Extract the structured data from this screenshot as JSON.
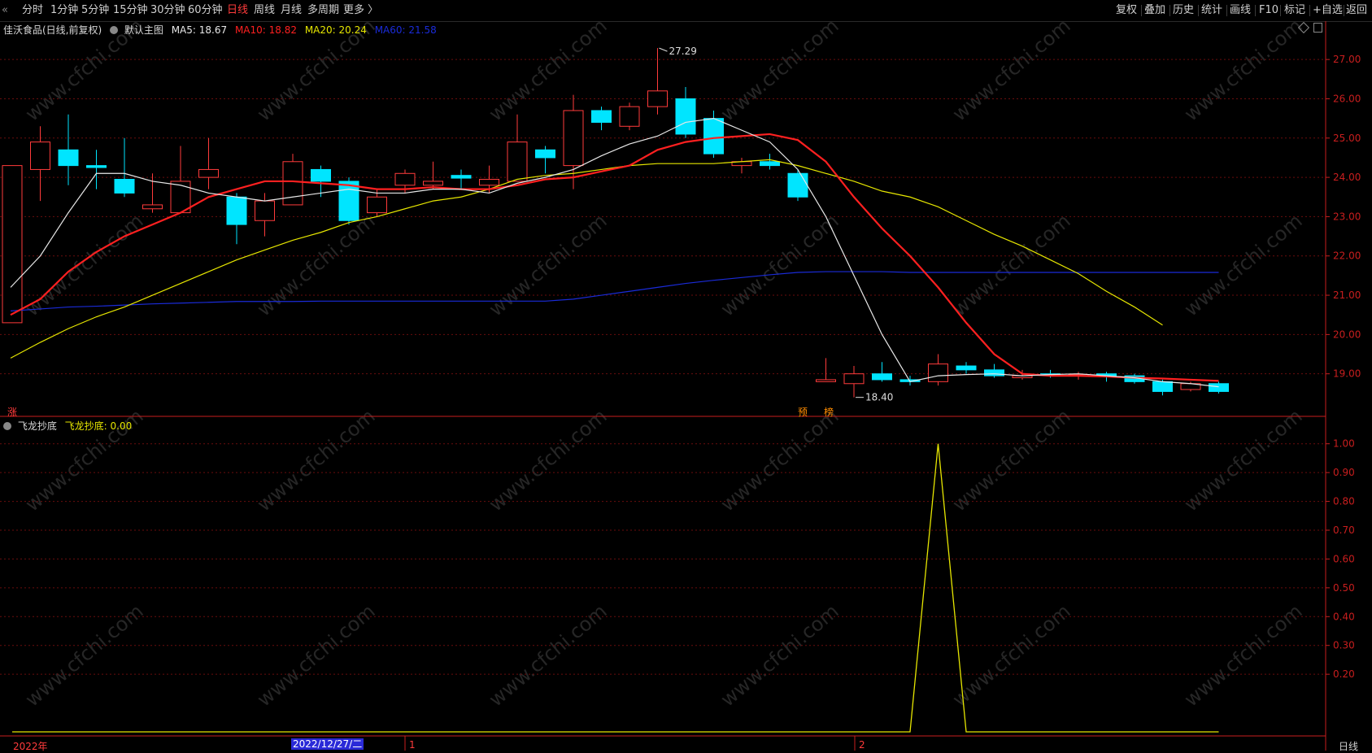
{
  "toolbar": {
    "periods": [
      "分时",
      "1分钟",
      "5分钟",
      "15分钟",
      "30分钟",
      "60分钟",
      "日线",
      "周线",
      "月线",
      "多周期",
      "更多 〉"
    ],
    "active": "日线",
    "right": [
      "复权",
      "叠加",
      "历史",
      "统计",
      "画线",
      "F10",
      "标记",
      "+自选",
      "返回"
    ]
  },
  "header": {
    "stock": "佳沃食品(日线,前复权)",
    "template": "默认主图",
    "ma5": "MA5: 18.67",
    "ma10": "MA10: 18.82",
    "ma20": "MA20: 20.24",
    "ma60": "MA60: 21.58"
  },
  "indicator": {
    "name": "飞龙抄底",
    "value": "飞龙抄底: 0.00"
  },
  "annotations": {
    "high": "27.29",
    "low": "18.40",
    "tag_zhang": "涨",
    "tag_yu": "预",
    "tag_bang": "榜"
  },
  "bottom": {
    "year": "2022年",
    "cursor_date": "2022/12/27/二",
    "month1": "1",
    "month2": "2",
    "period": "日线"
  },
  "watermark": "www.cfchi.com",
  "colors": {
    "up": "#ff3b3b",
    "down": "#00e5ff",
    "ma5": "#e8e8e8",
    "ma10": "#ff2020",
    "ma20": "#e6e600",
    "ma60": "#1a2bd8",
    "indicator": "#e6e600",
    "grid": "#6a0d0d",
    "axis": "#c81e1e"
  },
  "chart_data": [
    {
      "type": "candlestick",
      "title": "佳沃食品(日线,前复权)",
      "ylim": [
        18.0,
        27.5
      ],
      "yticks": [
        "27.00",
        "26.00",
        "25.00",
        "24.00",
        "23.00",
        "22.00",
        "21.00",
        "20.00",
        "19.00"
      ],
      "candles": [
        {
          "o": 20.3,
          "c": 24.3,
          "h": 24.3,
          "l": 20.3
        },
        {
          "o": 24.2,
          "c": 24.9,
          "h": 25.3,
          "l": 23.4
        },
        {
          "o": 24.7,
          "c": 24.3,
          "h": 25.6,
          "l": 23.8
        },
        {
          "o": 24.3,
          "c": 24.25,
          "h": 24.7,
          "l": 23.7
        },
        {
          "o": 23.95,
          "c": 23.6,
          "h": 25.0,
          "l": 23.5
        },
        {
          "o": 23.2,
          "c": 23.3,
          "h": 24.1,
          "l": 23.1
        },
        {
          "o": 23.1,
          "c": 23.9,
          "h": 24.8,
          "l": 23.1
        },
        {
          "o": 24.0,
          "c": 24.2,
          "h": 25.0,
          "l": 23.7
        },
        {
          "o": 23.5,
          "c": 22.8,
          "h": 23.6,
          "l": 22.3
        },
        {
          "o": 22.9,
          "c": 23.4,
          "h": 23.6,
          "l": 22.5
        },
        {
          "o": 23.3,
          "c": 24.4,
          "h": 24.6,
          "l": 23.3
        },
        {
          "o": 24.2,
          "c": 23.9,
          "h": 24.3,
          "l": 23.5
        },
        {
          "o": 23.9,
          "c": 22.9,
          "h": 24.0,
          "l": 22.8
        },
        {
          "o": 23.1,
          "c": 23.5,
          "h": 23.7,
          "l": 23.0
        },
        {
          "o": 23.8,
          "c": 24.1,
          "h": 24.2,
          "l": 23.6
        },
        {
          "o": 23.8,
          "c": 23.9,
          "h": 24.4,
          "l": 23.7
        },
        {
          "o": 24.05,
          "c": 23.98,
          "h": 24.2,
          "l": 23.7
        },
        {
          "o": 23.8,
          "c": 23.95,
          "h": 24.3,
          "l": 23.6
        },
        {
          "o": 23.9,
          "c": 24.9,
          "h": 25.6,
          "l": 23.9
        },
        {
          "o": 24.7,
          "c": 24.5,
          "h": 24.8,
          "l": 24.1
        },
        {
          "o": 24.3,
          "c": 25.7,
          "h": 26.1,
          "l": 23.7
        },
        {
          "o": 25.7,
          "c": 25.4,
          "h": 25.8,
          "l": 25.2
        },
        {
          "o": 25.3,
          "c": 25.8,
          "h": 25.9,
          "l": 25.2
        },
        {
          "o": 25.8,
          "c": 26.2,
          "h": 27.29,
          "l": 25.6
        },
        {
          "o": 26.0,
          "c": 25.1,
          "h": 26.3,
          "l": 25.0
        },
        {
          "o": 25.5,
          "c": 24.6,
          "h": 25.7,
          "l": 24.5
        },
        {
          "o": 24.3,
          "c": 24.4,
          "h": 24.5,
          "l": 24.1
        },
        {
          "o": 24.4,
          "c": 24.3,
          "h": 24.6,
          "l": 24.2
        },
        {
          "o": 24.1,
          "c": 23.5,
          "h": 24.2,
          "l": 23.4
        },
        {
          "o": 18.8,
          "c": 18.85,
          "h": 19.4,
          "l": 18.8
        },
        {
          "o": 18.75,
          "c": 19.0,
          "h": 19.2,
          "l": 18.4
        },
        {
          "o": 19.0,
          "c": 18.85,
          "h": 19.3,
          "l": 18.8
        },
        {
          "o": 18.85,
          "c": 18.8,
          "h": 18.95,
          "l": 18.7
        },
        {
          "o": 18.8,
          "c": 19.25,
          "h": 19.5,
          "l": 18.7
        },
        {
          "o": 19.2,
          "c": 19.1,
          "h": 19.3,
          "l": 19.0
        },
        {
          "o": 19.1,
          "c": 18.95,
          "h": 19.25,
          "l": 18.9
        },
        {
          "o": 18.9,
          "c": 18.95,
          "h": 19.1,
          "l": 18.85
        },
        {
          "o": 19.0,
          "c": 18.98,
          "h": 19.1,
          "l": 18.9
        },
        {
          "o": 18.95,
          "c": 18.98,
          "h": 19.05,
          "l": 18.85
        },
        {
          "o": 19.0,
          "c": 18.95,
          "h": 19.05,
          "l": 18.8
        },
        {
          "o": 18.95,
          "c": 18.8,
          "h": 19.0,
          "l": 18.75
        },
        {
          "o": 18.8,
          "c": 18.55,
          "h": 18.85,
          "l": 18.45
        },
        {
          "o": 18.6,
          "c": 18.75,
          "h": 18.8,
          "l": 18.55
        },
        {
          "o": 18.75,
          "c": 18.55,
          "h": 18.8,
          "l": 18.5
        }
      ],
      "ma5": [
        21.2,
        22.0,
        23.1,
        24.1,
        24.1,
        23.9,
        23.8,
        23.6,
        23.5,
        23.4,
        23.5,
        23.6,
        23.7,
        23.6,
        23.6,
        23.7,
        23.7,
        23.6,
        23.85,
        24.0,
        24.2,
        24.55,
        24.85,
        25.05,
        25.4,
        25.5,
        25.2,
        24.9,
        24.2,
        23.0,
        21.5,
        20.0,
        18.8,
        18.95,
        18.98,
        19.0,
        18.95,
        18.98,
        19.0,
        18.95,
        18.9,
        18.8,
        18.75,
        18.67
      ],
      "ma10": [
        20.5,
        20.9,
        21.6,
        22.1,
        22.5,
        22.8,
        23.1,
        23.5,
        23.7,
        23.9,
        23.9,
        23.85,
        23.8,
        23.7,
        23.7,
        23.75,
        23.7,
        23.7,
        23.8,
        23.95,
        24.0,
        24.15,
        24.3,
        24.7,
        24.9,
        25.0,
        25.05,
        25.1,
        24.95,
        24.4,
        23.5,
        22.7,
        22.0,
        21.2,
        20.3,
        19.5,
        19.0,
        18.95,
        18.95,
        18.93,
        18.9,
        18.88,
        18.85,
        18.82
      ],
      "ma20": [
        19.4,
        19.8,
        20.15,
        20.45,
        20.7,
        21.0,
        21.3,
        21.6,
        21.9,
        22.15,
        22.4,
        22.6,
        22.85,
        23.0,
        23.2,
        23.4,
        23.5,
        23.7,
        23.95,
        24.05,
        24.1,
        24.2,
        24.3,
        24.35,
        24.35,
        24.35,
        24.4,
        24.45,
        24.3,
        24.1,
        23.9,
        23.65,
        23.5,
        23.25,
        22.9,
        22.55,
        22.25,
        21.9,
        21.55,
        21.1,
        20.7,
        20.24
      ],
      "ma20_start": 0,
      "ma60": [
        20.6,
        20.65,
        20.7,
        20.72,
        20.75,
        20.78,
        20.8,
        20.82,
        20.84,
        20.84,
        20.84,
        20.85,
        20.85,
        20.85,
        20.85,
        20.85,
        20.85,
        20.85,
        20.85,
        20.85,
        20.9,
        21.0,
        21.1,
        21.2,
        21.3,
        21.38,
        21.45,
        21.52,
        21.58,
        21.6,
        21.6,
        21.6,
        21.58,
        21.58,
        21.58,
        21.58,
        21.58,
        21.58,
        21.58,
        21.58,
        21.58,
        21.58,
        21.58,
        21.58
      ]
    },
    {
      "type": "line",
      "title": "飞龙抄底",
      "ylim": [
        0,
        1.05
      ],
      "yticks": [
        "1.00",
        "0.90",
        "0.80",
        "0.70",
        "0.60",
        "0.50",
        "0.40",
        "0.30",
        "0.20"
      ],
      "series": [
        {
          "name": "飞龙抄底",
          "peak_index": 33,
          "peak_value": 1.0,
          "base_value": 0.0
        }
      ]
    }
  ]
}
